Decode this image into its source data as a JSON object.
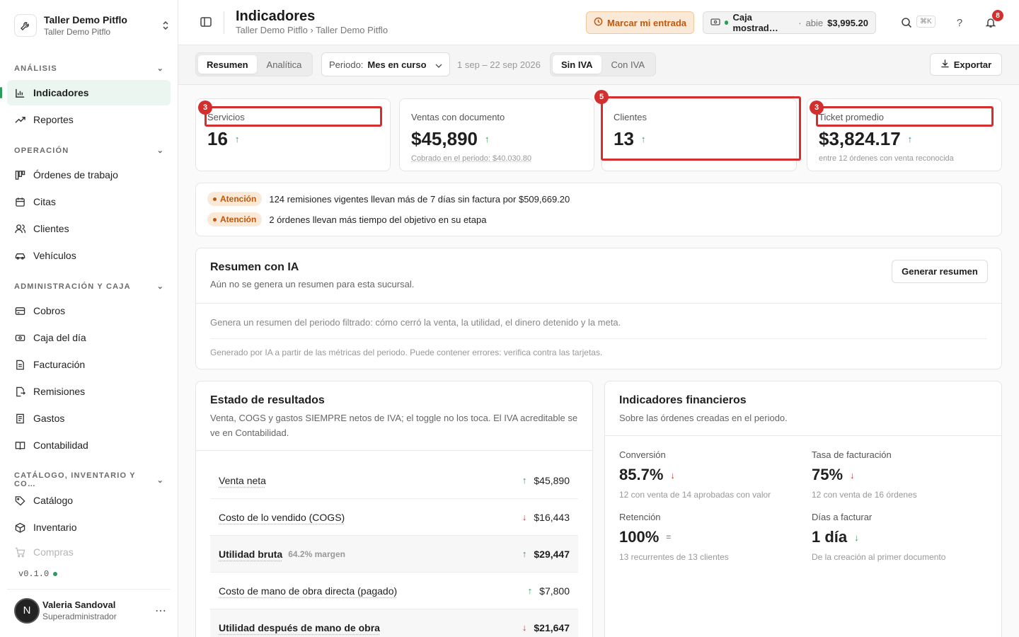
{
  "workspace": {
    "name": "Taller Demo Pitflo",
    "sub": "Taller Demo Pitflo"
  },
  "sidebar": {
    "sections": [
      {
        "title": "ANÁLISIS"
      },
      {
        "title": "OPERACIÓN"
      },
      {
        "title": "ADMINISTRACIÓN Y CAJA"
      },
      {
        "title": "CATÁLOGO, INVENTARIO Y CO…"
      }
    ],
    "items": [
      {
        "label": "Indicadores",
        "icon": "bar-chart-icon"
      },
      {
        "label": "Reportes",
        "icon": "trend-icon"
      },
      {
        "label": "Órdenes de trabajo",
        "icon": "kanban-icon"
      },
      {
        "label": "Citas",
        "icon": "calendar-icon"
      },
      {
        "label": "Clientes",
        "icon": "users-icon"
      },
      {
        "label": "Vehículos",
        "icon": "car-icon"
      },
      {
        "label": "Cobros",
        "icon": "card-icon"
      },
      {
        "label": "Caja del día",
        "icon": "cash-icon"
      },
      {
        "label": "Facturación",
        "icon": "document-icon"
      },
      {
        "label": "Remisiones",
        "icon": "export-doc-icon"
      },
      {
        "label": "Gastos",
        "icon": "receipt-icon"
      },
      {
        "label": "Contabilidad",
        "icon": "book-icon"
      },
      {
        "label": "Catálogo",
        "icon": "tag-icon"
      },
      {
        "label": "Inventario",
        "icon": "box-icon"
      },
      {
        "label": "Compras",
        "icon": "cart-icon"
      }
    ],
    "version": "v0.1.0",
    "user": {
      "initial": "N",
      "name": "Valeria Sandoval",
      "role": "Superadministrador"
    }
  },
  "header": {
    "title": "Indicadores",
    "breadcrumb": "Taller Demo Pitflo › Taller Demo Pitflo",
    "entry_label": "Marcar mi entrada",
    "caja": {
      "name": "Caja mostrad…",
      "status": "abie",
      "amount": "$3,995.20"
    },
    "kbd": "⌘K",
    "notifications": "8"
  },
  "filters": {
    "view_tabs": [
      "Resumen",
      "Analítica"
    ],
    "period_label": "Periodo:",
    "period_value": "Mes en curso",
    "date_range": "1 sep – 22 sep 2026",
    "tax_tabs": [
      "Sin IVA",
      "Con IVA"
    ],
    "export_label": "Exportar"
  },
  "kpis": [
    {
      "label": "Servicios",
      "value": "16",
      "sub": "",
      "badge": "3"
    },
    {
      "label": "Ventas con documento",
      "value": "$45,890",
      "sub": "Cobrado en el periodo: $40,030.80"
    },
    {
      "label": "Clientes",
      "value": "13",
      "sub": "",
      "badge": "5"
    },
    {
      "label": "Ticket promedio",
      "value": "$3,824.17",
      "sub": "entre 12 órdenes con venta reconocida",
      "badge": "3"
    }
  ],
  "alerts": [
    {
      "tag": "Atención",
      "text": "124 remisiones vigentes llevan más de 7 días sin factura por $509,669.20"
    },
    {
      "tag": "Atención",
      "text": "2 órdenes llevan más tiempo del objetivo en su etapa"
    }
  ],
  "ai_summary": {
    "title": "Resumen con IA",
    "subtitle": "Aún no se genera un resumen para esta sucursal.",
    "button": "Generar resumen",
    "description": "Genera un resumen del periodo filtrado: cómo cerró la venta, la utilidad, el dinero detenido y la meta.",
    "note": "Generado por IA a partir de las métricas del periodo. Puede contener errores: verifica contra las tarjetas."
  },
  "income_statement": {
    "title": "Estado de resultados",
    "subtitle": "Venta, COGS y gastos SIEMPRE netos de IVA; el toggle no los toca. El IVA acreditable se ve en Contabilidad.",
    "rows": [
      {
        "label": "Venta neta",
        "value": "$45,890",
        "trend": "up"
      },
      {
        "label": "Costo de lo vendido (COGS)",
        "value": "$16,443",
        "trend": "down"
      },
      {
        "label": "Utilidad bruta",
        "margin": "64.2% margen",
        "value": "$29,447",
        "trend": "up"
      },
      {
        "label": "Costo de mano de obra directa (pagado)",
        "value": "$7,800",
        "trend": "up"
      },
      {
        "label": "Utilidad después de mano de obra",
        "value": "$21,647",
        "trend": "down"
      }
    ]
  },
  "financial": {
    "title": "Indicadores financieros",
    "subtitle": "Sobre las órdenes creadas en el periodo.",
    "metrics": [
      {
        "label": "Conversión",
        "value": "85.7%",
        "sub": "12 con venta de 14 aprobadas con valor",
        "trend": "down"
      },
      {
        "label": "Tasa de facturación",
        "value": "75%",
        "sub": "12 con venta de 16 órdenes",
        "trend": "down"
      },
      {
        "label": "Retención",
        "value": "100%",
        "sub": "13 recurrentes de 13 clientes",
        "trend": "flat"
      },
      {
        "label": "Días a facturar",
        "value": "1 día",
        "sub": "De la creación al primer documento",
        "trend": "down"
      }
    ]
  },
  "colors": {
    "accent": "#2a9d5c",
    "warning": "#c2570c",
    "danger": "#d32f2f"
  }
}
